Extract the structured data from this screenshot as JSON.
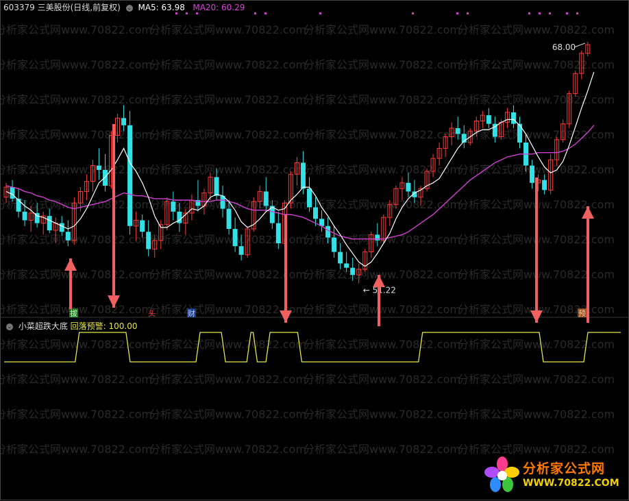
{
  "header": {
    "stock": "603379 三美股份(日线,前复权)",
    "ma5_label": "MA5: 63.98",
    "ma20_label": "MA20: 60.29"
  },
  "indicator": {
    "name": "小菜超跌大底",
    "value_label": "回落预警: 100.00"
  },
  "annotations": {
    "high_label": "68.00",
    "low_label": "51.22",
    "tags": [
      "拔",
      "头",
      "财",
      "预"
    ]
  },
  "watermark": {
    "text": "分析家公式网www.70822.com"
  },
  "logo": {
    "name": "分析家公式网",
    "url": "WWW.70822.COM"
  },
  "colors": {
    "up": "#ff3b3b",
    "down": "#33e0e6",
    "ma5": "#ffffff",
    "ma20": "#d040d0",
    "indicator": "#e6e64a",
    "arrow": "#f06060"
  },
  "chart_data": [
    {
      "type": "candlestick",
      "title": "603379 三美股份(日线,前复权)",
      "ylim": [
        50,
        70
      ],
      "high_label": 68.0,
      "low_label": 51.22,
      "candles": [
        [
          57.2,
          58.2,
          56.8,
          57.9
        ],
        [
          57.9,
          58.4,
          56.9,
          57.1
        ],
        [
          57.1,
          57.8,
          55.8,
          56.2
        ],
        [
          56.2,
          57.0,
          55.2,
          55.6
        ],
        [
          55.6,
          56.6,
          54.8,
          56.1
        ],
        [
          56.1,
          56.8,
          55.1,
          55.4
        ],
        [
          55.4,
          56.2,
          54.6,
          55.9
        ],
        [
          55.9,
          56.4,
          54.7,
          54.9
        ],
        [
          54.9,
          55.8,
          54.0,
          55.4
        ],
        [
          55.4,
          55.9,
          54.5,
          54.8
        ],
        [
          54.8,
          55.6,
          53.8,
          54.2
        ],
        [
          54.2,
          57.2,
          53.9,
          56.8
        ],
        [
          56.8,
          57.9,
          56.2,
          57.6
        ],
        [
          57.6,
          58.8,
          57.0,
          58.3
        ],
        [
          58.3,
          59.8,
          57.6,
          59.4
        ],
        [
          59.4,
          60.6,
          58.4,
          59.1
        ],
        [
          59.1,
          60.2,
          57.6,
          58.0
        ],
        [
          58.0,
          61.8,
          57.8,
          61.5
        ],
        [
          61.5,
          63.0,
          61.0,
          62.7
        ],
        [
          62.7,
          63.6,
          61.8,
          62.2
        ],
        [
          62.2,
          63.2,
          54.6,
          55.2
        ],
        [
          55.2,
          56.2,
          54.2,
          55.6
        ],
        [
          55.6,
          56.0,
          54.4,
          54.8
        ],
        [
          54.8,
          55.6,
          53.1,
          53.6
        ],
        [
          53.6,
          54.6,
          53.0,
          54.2
        ],
        [
          54.2,
          55.6,
          53.6,
          55.3
        ],
        [
          55.3,
          57.2,
          54.9,
          56.9
        ],
        [
          56.9,
          57.6,
          55.6,
          56.2
        ],
        [
          56.2,
          56.8,
          54.8,
          55.4
        ],
        [
          55.4,
          56.4,
          54.6,
          56.1
        ],
        [
          56.1,
          57.4,
          55.6,
          57.0
        ],
        [
          57.0,
          58.4,
          56.2,
          56.6
        ],
        [
          56.6,
          57.8,
          56.0,
          57.5
        ],
        [
          57.5,
          58.9,
          57.0,
          58.6
        ],
        [
          58.6,
          59.2,
          57.0,
          57.3
        ],
        [
          57.3,
          58.0,
          55.8,
          56.4
        ],
        [
          56.4,
          57.0,
          54.6,
          55.0
        ],
        [
          55.0,
          55.8,
          53.4,
          53.8
        ],
        [
          53.8,
          54.6,
          52.8,
          53.2
        ],
        [
          53.2,
          55.2,
          53.0,
          55.0
        ],
        [
          55.0,
          57.2,
          54.8,
          56.9
        ],
        [
          56.9,
          58.0,
          56.4,
          57.6
        ],
        [
          57.6,
          58.6,
          56.2,
          56.6
        ],
        [
          56.6,
          57.0,
          55.0,
          55.4
        ],
        [
          55.4,
          56.2,
          53.6,
          54.0
        ],
        [
          54.0,
          57.0,
          53.8,
          56.8
        ],
        [
          56.8,
          59.0,
          56.4,
          58.8
        ],
        [
          58.8,
          60.0,
          58.0,
          59.6
        ],
        [
          59.6,
          60.4,
          57.4,
          57.8
        ],
        [
          57.8,
          58.6,
          56.2,
          56.5
        ],
        [
          56.5,
          57.2,
          55.2,
          55.7
        ],
        [
          55.7,
          56.3,
          54.8,
          55.2
        ],
        [
          55.2,
          55.8,
          54.0,
          54.4
        ],
        [
          54.4,
          55.2,
          53.0,
          53.4
        ],
        [
          53.4,
          54.0,
          52.2,
          52.6
        ],
        [
          52.6,
          53.4,
          52.0,
          52.3
        ],
        [
          52.3,
          53.0,
          51.4,
          51.8
        ],
        [
          51.8,
          52.6,
          51.22,
          52.2
        ],
        [
          52.2,
          53.6,
          52.0,
          53.4
        ],
        [
          53.4,
          54.8,
          53.0,
          54.6
        ],
        [
          54.6,
          55.4,
          53.8,
          54.2
        ],
        [
          54.2,
          56.0,
          54.0,
          55.8
        ],
        [
          55.8,
          57.0,
          55.2,
          56.7
        ],
        [
          56.7,
          58.0,
          56.4,
          57.8
        ],
        [
          57.8,
          58.6,
          57.0,
          58.2
        ],
        [
          58.2,
          58.9,
          57.2,
          57.6
        ],
        [
          57.6,
          58.4,
          56.8,
          57.2
        ],
        [
          57.2,
          58.0,
          56.6,
          57.8
        ],
        [
          57.8,
          59.2,
          57.6,
          59.0
        ],
        [
          59.0,
          60.2,
          58.6,
          59.9
        ],
        [
          59.9,
          61.0,
          59.4,
          60.6
        ],
        [
          60.6,
          61.6,
          60.0,
          61.4
        ],
        [
          61.4,
          62.4,
          60.8,
          62.0
        ],
        [
          62.0,
          62.8,
          61.2,
          61.6
        ],
        [
          61.6,
          62.2,
          60.6,
          61.0
        ],
        [
          61.0,
          62.0,
          60.8,
          61.8
        ],
        [
          61.8,
          62.8,
          61.4,
          62.5
        ],
        [
          62.5,
          63.2,
          62.0,
          62.9
        ],
        [
          62.9,
          63.4,
          62.0,
          62.3
        ],
        [
          62.3,
          62.8,
          61.0,
          61.4
        ],
        [
          61.4,
          62.6,
          61.2,
          62.4
        ],
        [
          62.4,
          63.4,
          62.0,
          63.1
        ],
        [
          63.1,
          63.6,
          62.0,
          62.3
        ],
        [
          62.3,
          62.8,
          60.6,
          61.0
        ],
        [
          61.0,
          61.6,
          59.0,
          59.4
        ],
        [
          59.4,
          59.8,
          57.8,
          58.2
        ],
        [
          58.2,
          58.8,
          57.6,
          58.4
        ],
        [
          58.4,
          58.8,
          57.4,
          57.7
        ],
        [
          57.7,
          60.2,
          57.4,
          59.8
        ],
        [
          59.8,
          61.4,
          59.4,
          61.2
        ],
        [
          61.2,
          62.6,
          61.0,
          62.3
        ],
        [
          62.3,
          64.6,
          62.0,
          64.4
        ],
        [
          64.4,
          66.0,
          64.2,
          65.8
        ],
        [
          65.8,
          67.4,
          65.4,
          67.2
        ],
        [
          67.2,
          68.0,
          67.0,
          67.8
        ]
      ],
      "ma5": [
        57.6,
        57.4,
        57.0,
        56.6,
        56.3,
        55.9,
        55.8,
        55.6,
        55.4,
        55.2,
        55.0,
        55.2,
        55.7,
        56.4,
        57.3,
        58.2,
        58.6,
        59.1,
        59.8,
        60.6,
        59.6,
        59.0,
        58.2,
        57.2,
        55.9,
        55.1,
        55.1,
        55.4,
        55.6,
        56.0,
        56.4,
        56.3,
        56.6,
        57.2,
        57.4,
        57.3,
        56.9,
        56.3,
        55.5,
        55.1,
        55.3,
        55.7,
        56.2,
        56.5,
        56.3,
        56.4,
        57.0,
        57.4,
        57.9,
        57.9,
        57.3,
        56.5,
        55.9,
        55.2,
        54.6,
        53.9,
        53.3,
        52.7,
        52.4,
        52.7,
        53.3,
        54.0,
        54.7,
        55.7,
        56.5,
        57.1,
        57.5,
        57.7,
        58.0,
        58.2,
        58.5,
        59.2,
        59.9,
        60.6,
        61.1,
        61.4,
        61.7,
        61.9,
        61.9,
        62.1,
        62.4,
        62.6,
        62.6,
        62.2,
        61.6,
        60.8,
        60.0,
        59.3,
        58.9,
        59.1,
        59.7,
        60.8,
        62.1,
        63.4,
        64.6,
        65.9
      ],
      "ma20": [
        58.0,
        57.9,
        57.8,
        57.6,
        57.5,
        57.3,
        57.2,
        57.0,
        56.9,
        56.7,
        56.5,
        56.4,
        56.5,
        56.6,
        56.7,
        56.8,
        56.9,
        57.1,
        57.3,
        57.5,
        57.4,
        57.3,
        57.3,
        57.2,
        57.1,
        57.1,
        57.1,
        57.0,
        57.0,
        57.0,
        57.0,
        56.9,
        56.9,
        56.9,
        57.0,
        57.0,
        56.9,
        56.8,
        56.6,
        56.4,
        56.3,
        56.3,
        56.3,
        56.2,
        56.1,
        56.0,
        56.0,
        55.9,
        55.8,
        55.6,
        55.4,
        55.2,
        54.9,
        54.7,
        54.5,
        54.4,
        54.3,
        54.3,
        54.3,
        54.3,
        54.3,
        54.3,
        54.4,
        54.5,
        54.6,
        54.8,
        55.1,
        55.4,
        55.7,
        56.0,
        56.4,
        56.8,
        57.2,
        57.6,
        58.0,
        58.4,
        58.7,
        59.0,
        59.3,
        59.6,
        59.8,
        60.0,
        60.1,
        60.2,
        60.2,
        60.2,
        60.3,
        60.3,
        60.3,
        60.3,
        60.4,
        60.6,
        60.9,
        61.3,
        61.7,
        62.2
      ]
    },
    {
      "type": "step-line",
      "title": "小菜超跌大底",
      "series": [
        {
          "name": "回落预警",
          "values": [
            0,
            0,
            0,
            0,
            0,
            0,
            0,
            0,
            0,
            0,
            0,
            0,
            100,
            100,
            100,
            100,
            100,
            100,
            100,
            100,
            0,
            0,
            0,
            0,
            0,
            0,
            0,
            0,
            0,
            0,
            0,
            100,
            100,
            100,
            100,
            0,
            0,
            0,
            0,
            100,
            0,
            0,
            100,
            100,
            100,
            100,
            100,
            0,
            0,
            0,
            0,
            0,
            0,
            0,
            0,
            0,
            0,
            0,
            0,
            0,
            0,
            0,
            0,
            0,
            0,
            0,
            100,
            100,
            100,
            100,
            100,
            100,
            100,
            100,
            100,
            100,
            100,
            100,
            100,
            100,
            100,
            100,
            100,
            100,
            100,
            0,
            0,
            0,
            0,
            0,
            0,
            0,
            100,
            100,
            100,
            100,
            100,
            100
          ]
        }
      ],
      "ylim": [
        0,
        100
      ]
    }
  ]
}
